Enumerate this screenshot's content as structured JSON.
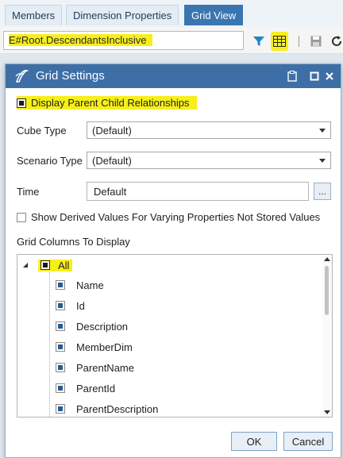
{
  "tabs": [
    "Members",
    "Dimension Properties",
    "Grid View"
  ],
  "filter": {
    "value": "E#Root.DescendantsInclusive"
  },
  "toolbar": {
    "icons": [
      "filter-icon",
      "grid-settings-icon",
      "save-icon",
      "refresh-icon"
    ],
    "accent": "#f7ef1a"
  },
  "dialog": {
    "title": "Grid Settings",
    "display_parent_child": "Display Parent Child Relationships",
    "cube_type": {
      "label": "Cube Type",
      "value": "(Default)"
    },
    "scenario_type": {
      "label": "Scenario Type",
      "value": "(Default)"
    },
    "time": {
      "label": "Time",
      "value": "Default",
      "button": "..."
    },
    "show_derived": "Show Derived Values For Varying Properties Not Stored Values",
    "grid_columns_label": "Grid Columns To Display",
    "tree": {
      "root": "All",
      "children": [
        "Name",
        "Id",
        "Description",
        "MemberDim",
        "ParentName",
        "ParentId",
        "ParentDescription"
      ]
    },
    "ok": "OK",
    "cancel": "Cancel"
  },
  "colors": {
    "titlebar": "#3d6fa6",
    "tab_active": "#3a75b0",
    "highlight": "#f7ef1a"
  }
}
